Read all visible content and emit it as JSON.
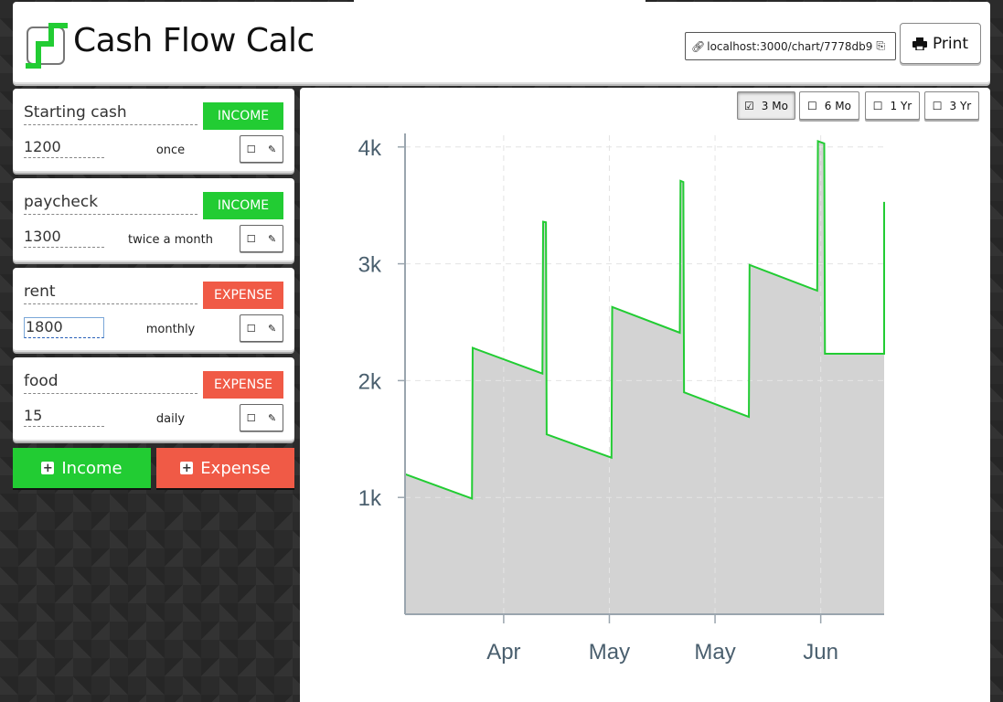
{
  "app": {
    "title": "Cash Flow Calc",
    "url": "localhost:3000/chart/7778db9",
    "print_label": "Print",
    "brand_green": "#22cc33",
    "expense_red": "#f05a46"
  },
  "entries": [
    {
      "name": "Starting cash",
      "type": "INCOME",
      "amount": "1200",
      "frequency": "once"
    },
    {
      "name": "paycheck",
      "type": "INCOME",
      "amount": "1300",
      "frequency": "twice a month"
    },
    {
      "name": "rent",
      "type": "EXPENSE",
      "amount": "1800",
      "frequency": "monthly"
    },
    {
      "name": "food",
      "type": "EXPENSE",
      "amount": "15",
      "frequency": "daily"
    }
  ],
  "entry_tool_icons": [
    "checkbox-icon",
    "pencil-icon"
  ],
  "add_buttons": {
    "income": "Income",
    "expense": "Expense"
  },
  "ranges": [
    {
      "label": "3 Mo",
      "checked": true
    },
    {
      "label": "6 Mo",
      "checked": false
    },
    {
      "label": "1 Yr",
      "checked": false
    },
    {
      "label": "3 Yr",
      "checked": false
    }
  ],
  "chart_data": {
    "type": "area",
    "y_ticks": [
      {
        "value": 1000,
        "label": "1k"
      },
      {
        "value": 2000,
        "label": "2k"
      },
      {
        "value": 3000,
        "label": "3k"
      },
      {
        "value": 4000,
        "label": "4k"
      }
    ],
    "x_ticks": [
      {
        "day": 14,
        "label": "Apr"
      },
      {
        "day": 29,
        "label": "May"
      },
      {
        "day": 44,
        "label": "May"
      },
      {
        "day": 59,
        "label": "Jun"
      }
    ],
    "ylim": [
      0,
      4100
    ],
    "xlim": [
      0,
      68
    ],
    "grid": true,
    "line_color": "#22cc33",
    "fill_color": "#d3d3d3",
    "points": [
      [
        0,
        1200
      ],
      [
        9.5,
        990
      ],
      [
        9.6,
        2280
      ],
      [
        19.5,
        2060
      ],
      [
        19.6,
        3360
      ],
      [
        20,
        3355
      ],
      [
        20.1,
        1540
      ],
      [
        29.3,
        1340
      ],
      [
        29.4,
        2630
      ],
      [
        39,
        2410
      ],
      [
        39.1,
        3710
      ],
      [
        39.5,
        3700
      ],
      [
        39.6,
        1900
      ],
      [
        48.8,
        1690
      ],
      [
        48.9,
        2990
      ],
      [
        58.5,
        2770
      ],
      [
        58.6,
        4050
      ],
      [
        59.5,
        4030
      ],
      [
        59.6,
        2230
      ],
      [
        68,
        2230
      ],
      [
        68,
        3530
      ]
    ]
  }
}
